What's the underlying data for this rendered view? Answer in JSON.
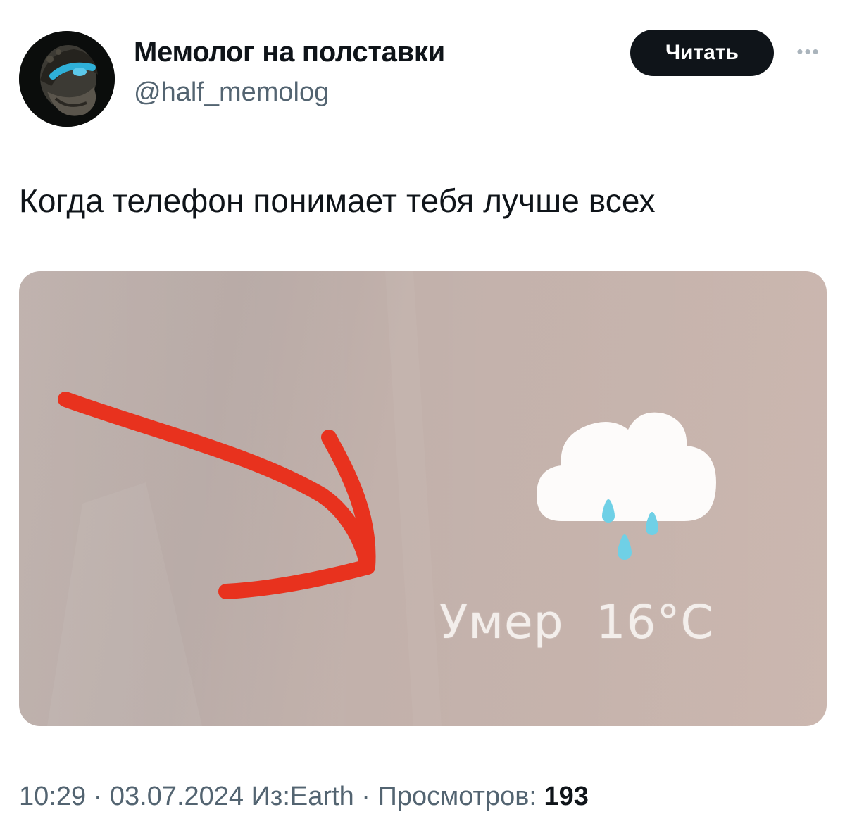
{
  "author": {
    "display_name": "Мемолог на полставки",
    "handle": "@half_memolog"
  },
  "follow_button_label": "Читать",
  "more_icon": "more-horizontal-icon",
  "tweet_text": "Когда телефон понимает тебя лучше всех",
  "media": {
    "weather_word": "Умер",
    "temperature": "16°C",
    "weather_icon": "cloud-rain-icon",
    "annotation": "red-arrow"
  },
  "meta": {
    "time": "10:29",
    "separator1": " · ",
    "date": "03.07.2024",
    "source": " Из:Earth",
    "separator2": " · ",
    "views_label": "Просмотров: ",
    "views_count": "193"
  },
  "colors": {
    "arrow": "#e8321e",
    "raindrop": "#6fd0e6",
    "follow_bg": "#0f1419",
    "secondary_text": "#536471"
  }
}
